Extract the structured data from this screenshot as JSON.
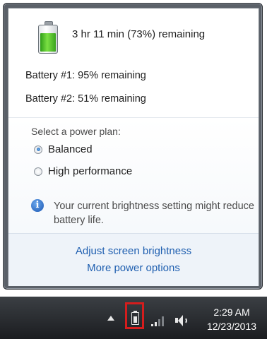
{
  "flyout": {
    "summary": "3 hr 11 min (73%) remaining",
    "battery1": "Battery #1: 95% remaining",
    "battery2": "Battery #2: 51% remaining",
    "charge_level": 0.73
  },
  "power_plan": {
    "label": "Select a power plan:",
    "options": [
      {
        "label": "Balanced",
        "selected": true
      },
      {
        "label": "High performance",
        "selected": false
      }
    ]
  },
  "info": {
    "icon": "info-icon",
    "text": "Your current brightness setting might reduce battery life."
  },
  "links": {
    "adjust_brightness": "Adjust screen brightness",
    "more_power": "More power options"
  },
  "taskbar": {
    "time": "2:29 AM",
    "date": "12/23/2013",
    "highlight_color": "#d51d1d",
    "icons": [
      "show-hidden-icons",
      "battery-icon",
      "network-signal-icon",
      "speaker-icon"
    ]
  }
}
